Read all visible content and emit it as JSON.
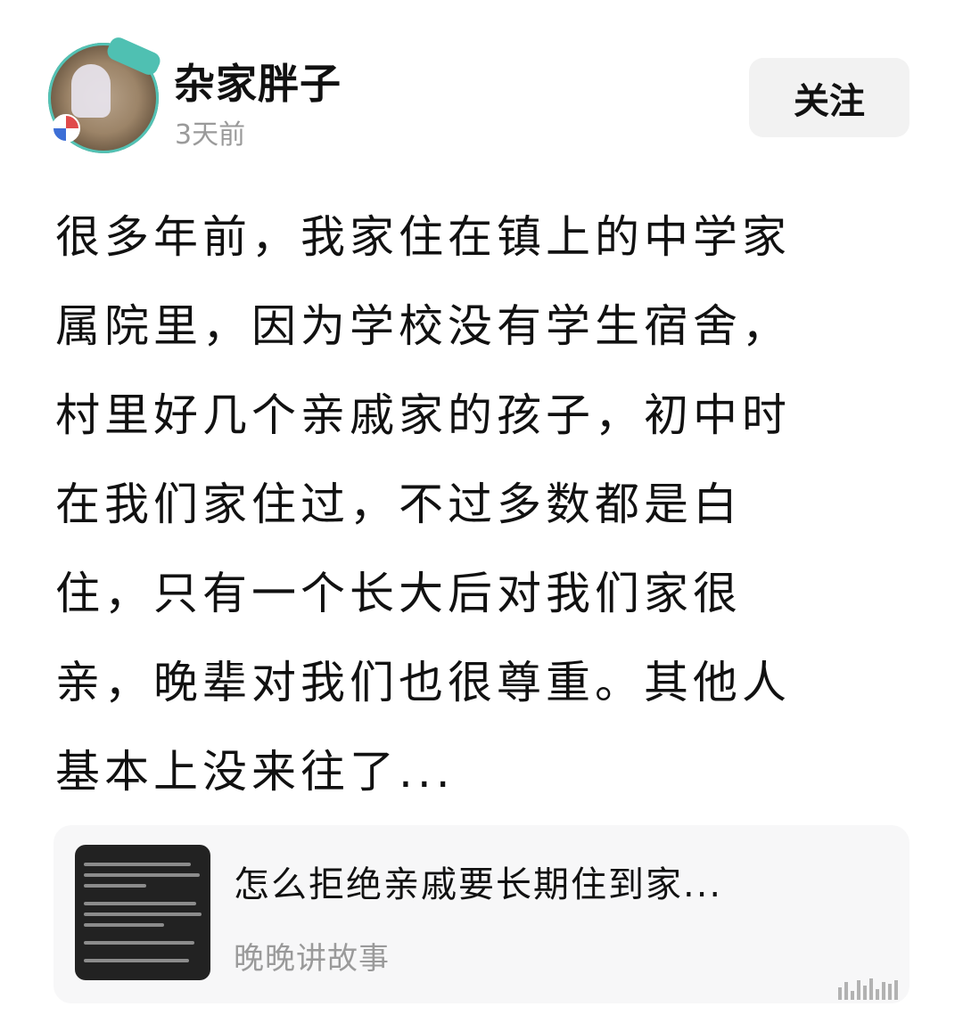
{
  "author": {
    "name": "杂家胖子",
    "time": "3天前",
    "avatar_badge_icon": "peak-badge-icon"
  },
  "follow_button": {
    "label": "关注"
  },
  "post": {
    "lines": [
      "很多年前，我家住在镇上的中学家",
      "属院里，因为学校没有学生宿舍，",
      "村里好几个亲戚家的孩子，初中时",
      "在我们家住过，不过多数都是白",
      "住，只有一个长大后对我们家很",
      "亲，晚辈对我们也很尊重。其他人",
      "基本上没来往了..."
    ]
  },
  "linked_article": {
    "title": "怎么拒绝亲戚要长期住到家...",
    "source": "晚晚讲故事"
  },
  "colors": {
    "text_primary": "#111111",
    "text_secondary": "#9a9a9a",
    "follow_bg": "#f2f2f2",
    "card_bg": "#f7f7f8",
    "avatar_ring": "#53c2b4"
  }
}
